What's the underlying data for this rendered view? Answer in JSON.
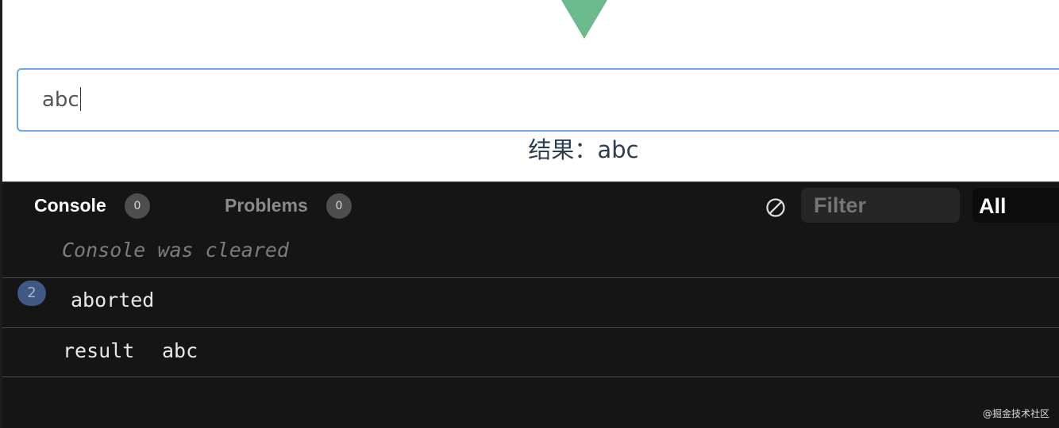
{
  "preview": {
    "input_value": "abc",
    "result_label": "结果：",
    "result_value": "abc",
    "logo_color": "#6bb98c"
  },
  "console_panel": {
    "tabs": [
      {
        "label": "Console",
        "badge": "0",
        "active": true
      },
      {
        "label": "Problems",
        "badge": "0",
        "active": false
      }
    ],
    "clear_icon": "circle-slash-icon",
    "filter_placeholder": "Filter",
    "level_select": "All",
    "logs": [
      {
        "text": "Console was cleared",
        "type": "info"
      },
      {
        "repeat_count": "2",
        "text": "aborted"
      },
      {
        "key": "result",
        "value": "abc"
      }
    ]
  },
  "watermark": "@掘金技术社区"
}
